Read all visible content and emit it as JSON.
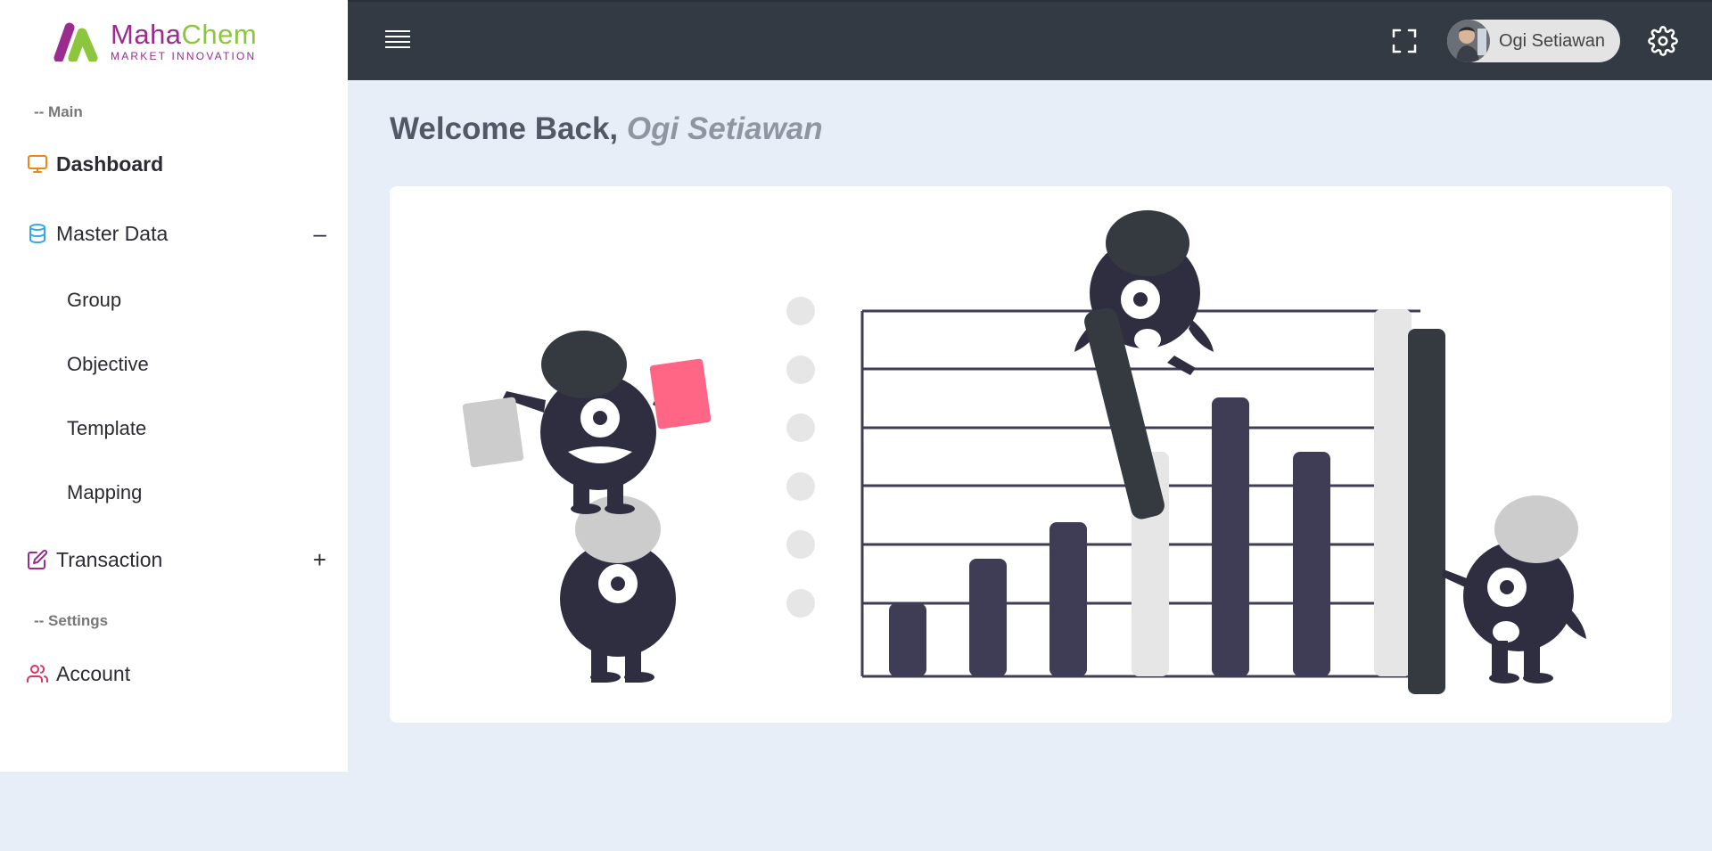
{
  "brand": {
    "name_part1": "Maha",
    "name_part2": "Chem",
    "tagline": "MARKET INNOVATION",
    "colors": {
      "purple": "#9b2c8f",
      "green": "#8cc63f"
    }
  },
  "sidebar": {
    "section_main": "-- Main",
    "section_settings": "-- Settings",
    "items": [
      {
        "label": "Dashboard",
        "icon": "monitor-icon",
        "active": true
      },
      {
        "label": "Master Data",
        "icon": "database-icon",
        "toggle": "–",
        "expanded": true,
        "children": [
          "Group",
          "Objective",
          "Template",
          "Mapping"
        ]
      },
      {
        "label": "Transaction",
        "icon": "edit-icon",
        "toggle": "+",
        "expanded": false
      },
      {
        "label": "Account",
        "icon": "users-icon"
      }
    ]
  },
  "topbar": {
    "menu_icon": "hamburger-icon",
    "fullscreen_icon": "fullscreen-icon",
    "user_name": "Ogi Setiawan",
    "settings_icon": "gear-icon",
    "background": "#343a44"
  },
  "main": {
    "welcome_prefix": "Welcome Back, ",
    "welcome_name": "Ogi Setiawan"
  },
  "colors": {
    "page_bg": "#e8eef7",
    "dashboard_icon": "#f0861a",
    "master_data_icon": "#3aa6e8",
    "transaction_icon": "#9b2c8f",
    "account_icon": "#e0325e"
  }
}
